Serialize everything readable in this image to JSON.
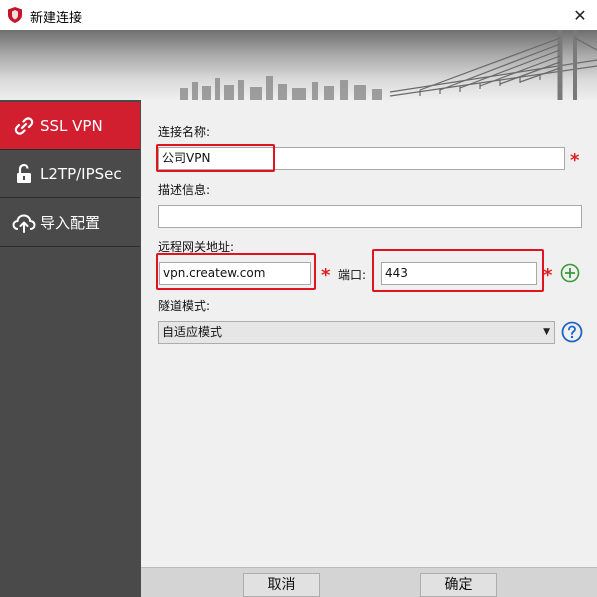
{
  "window": {
    "title": "新建连接",
    "close_glyph": "✕",
    "icon": "shield-icon"
  },
  "sidebar": {
    "items": [
      {
        "label": "SSL VPN",
        "icon": "link-icon",
        "active": true
      },
      {
        "label": "L2TP/IPSec",
        "icon": "unlock-icon",
        "active": false
      },
      {
        "label": "导入配置",
        "icon": "cloud-upload-icon",
        "active": false
      }
    ]
  },
  "form": {
    "name_label": "连接名称:",
    "name_value": "公司VPN",
    "desc_label": "描述信息:",
    "desc_value": "",
    "remote_label": "远程网关地址:",
    "remote_value": "vpn.createw.com",
    "port_label": "端口:",
    "port_value": "443",
    "tunnel_label": "隧道模式:",
    "tunnel_value": "自适应模式",
    "required_mark": "*"
  },
  "buttons": {
    "cancel": "取消",
    "ok": "确定"
  },
  "colors": {
    "accent": "#d21f30",
    "sidebar_bg": "#4a4a4a",
    "add_green": "#3a9a3a",
    "help_blue": "#1e64c8"
  }
}
